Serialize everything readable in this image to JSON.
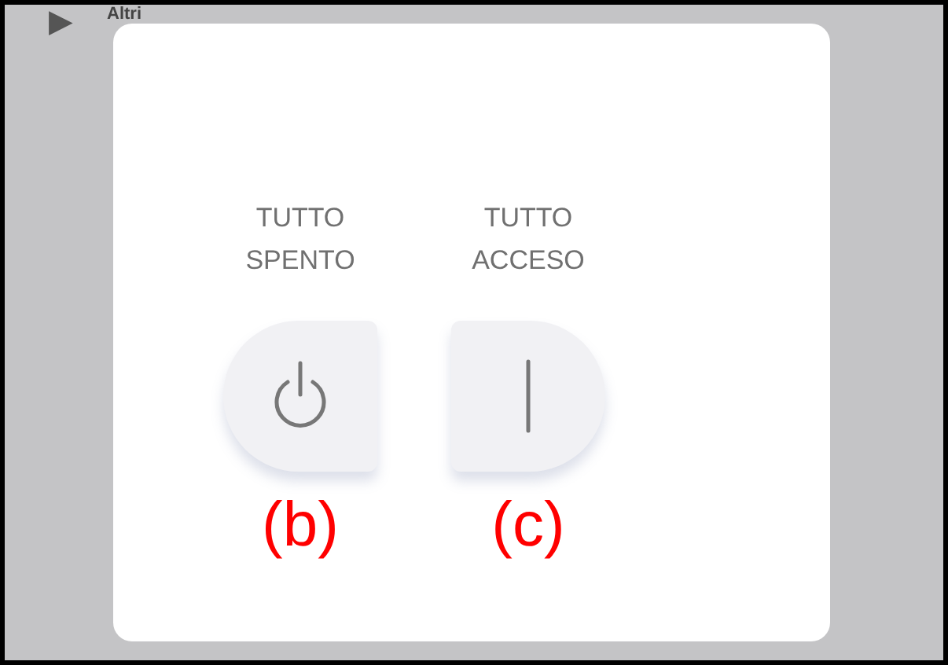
{
  "background": {
    "item_label": "Altri",
    "expander": "▶"
  },
  "dialog": {
    "options": [
      {
        "kind": "off",
        "label": "TUTTO SPENTO",
        "annotation": "(b)"
      },
      {
        "kind": "on",
        "label": "TUTTO ACCESO",
        "annotation": "(c)"
      }
    ]
  }
}
